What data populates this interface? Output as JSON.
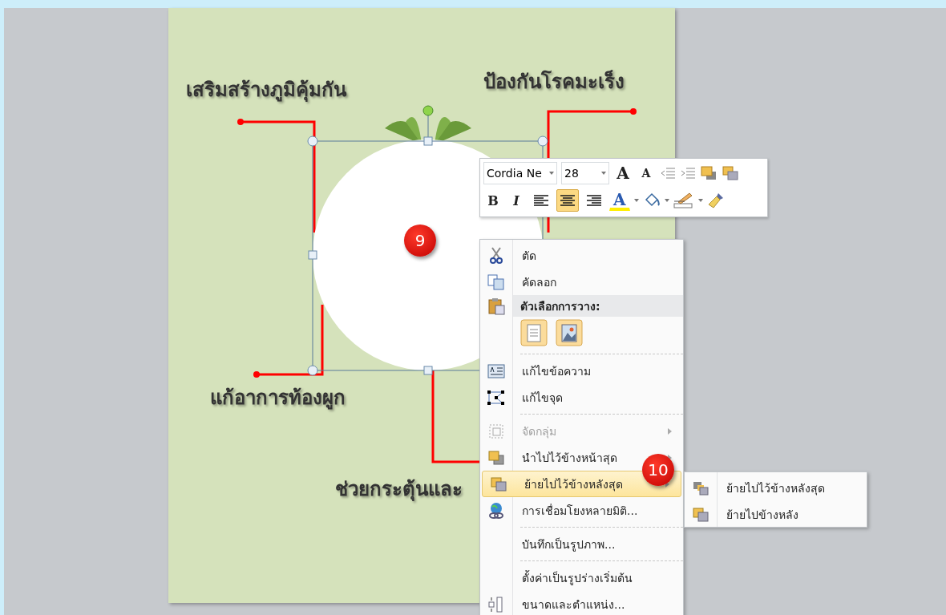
{
  "slide": {
    "labels": [
      "เสริมสร้างภูมิคุ้มกัน",
      "ป้องกันโรคมะเร็ง",
      "แก้อาการท้องผูก",
      "ช่วยกระตุ้นและ"
    ]
  },
  "step_badges": [
    "9",
    "10"
  ],
  "mini_toolbar": {
    "font": "Cordia Ne",
    "size": "28",
    "grow_font": "A",
    "shrink_font": "A",
    "bold": "B",
    "italic": "I",
    "font_color": "A",
    "align": [
      {
        "selected": false
      },
      {
        "selected": true
      },
      {
        "selected": false
      }
    ]
  },
  "context_menu": {
    "items": [
      {
        "kind": "item",
        "label": "ตัด",
        "disabled": false,
        "selected": false,
        "submenu": false
      },
      {
        "kind": "item",
        "label": "คัดลอก",
        "disabled": false,
        "selected": false,
        "submenu": false
      },
      {
        "kind": "header",
        "label": "ตัวเลือกการวาง:"
      },
      {
        "kind": "paste-options"
      },
      {
        "kind": "separator"
      },
      {
        "kind": "item",
        "label": "แก้ไขข้อความ",
        "disabled": false,
        "selected": false,
        "submenu": false
      },
      {
        "kind": "item",
        "label": "แก้ไขจุด",
        "disabled": false,
        "selected": false,
        "submenu": false
      },
      {
        "kind": "separator"
      },
      {
        "kind": "item",
        "label": "จัดกลุ่ม",
        "disabled": true,
        "selected": false,
        "submenu": true
      },
      {
        "kind": "item",
        "label": "นำไปไว้ข้างหน้าสุด",
        "disabled": false,
        "selected": false,
        "submenu": true
      },
      {
        "kind": "item",
        "label": "ย้ายไปไว้ข้างหลังสุด",
        "disabled": false,
        "selected": true,
        "submenu": true
      },
      {
        "kind": "item",
        "label": "การเชื่อมโยงหลายมิติ...",
        "disabled": false,
        "selected": false,
        "submenu": false
      },
      {
        "kind": "separator"
      },
      {
        "kind": "item",
        "label": "บันทึกเป็นรูปภาพ...",
        "disabled": false,
        "selected": false,
        "submenu": false
      },
      {
        "kind": "separator"
      },
      {
        "kind": "item",
        "label": "ตั้งค่าเป็นรูปร่างเริ่มต้น",
        "disabled": false,
        "selected": false,
        "submenu": false
      },
      {
        "kind": "item",
        "label": "ขนาดและตำแหน่ง...",
        "disabled": false,
        "selected": false,
        "submenu": false
      }
    ]
  },
  "submenu": {
    "items": [
      {
        "label": "ย้ายไปไว้ข้างหลังสุด"
      },
      {
        "label": "ย้ายไปข้างหลัง"
      }
    ]
  }
}
